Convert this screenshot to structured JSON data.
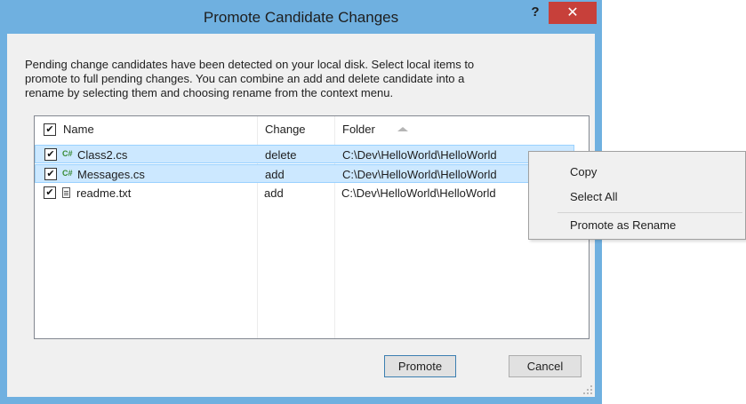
{
  "window": {
    "title": "Promote Candidate Changes",
    "help": "?",
    "close": "✕"
  },
  "description": [
    "Pending change candidates have been detected on your local disk. Select local items to",
    "promote to full pending changes. You can combine an add and delete candidate into a",
    "rename by selecting them and choosing rename from the context menu."
  ],
  "columns": {
    "name": "Name",
    "change": "Change",
    "folder": "Folder"
  },
  "rows": [
    {
      "icon": "csharp-file-icon",
      "icon_text": "C#",
      "name": "Class2.cs",
      "change": "delete",
      "folder": "C:\\Dev\\HelloWorld\\HelloWorld",
      "checked": true,
      "selected": true
    },
    {
      "icon": "csharp-file-icon",
      "icon_text": "C#",
      "name": "Messages.cs",
      "change": "add",
      "folder": "C:\\Dev\\HelloWorld\\HelloWorld",
      "checked": true,
      "selected": true
    },
    {
      "icon": "text-file-icon",
      "icon_text": "",
      "name": "readme.txt",
      "change": "add",
      "folder": "C:\\Dev\\HelloWorld\\HelloWorld",
      "checked": true,
      "selected": false
    }
  ],
  "buttons": {
    "promote": "Promote",
    "cancel": "Cancel"
  },
  "context_menu": {
    "copy": "Copy",
    "select_all": "Select All",
    "promote_as_rename": "Promote as Rename"
  },
  "colors": {
    "frame": "#6fb0e0",
    "close_button": "#c7403a",
    "selection": "#cce8ff"
  }
}
